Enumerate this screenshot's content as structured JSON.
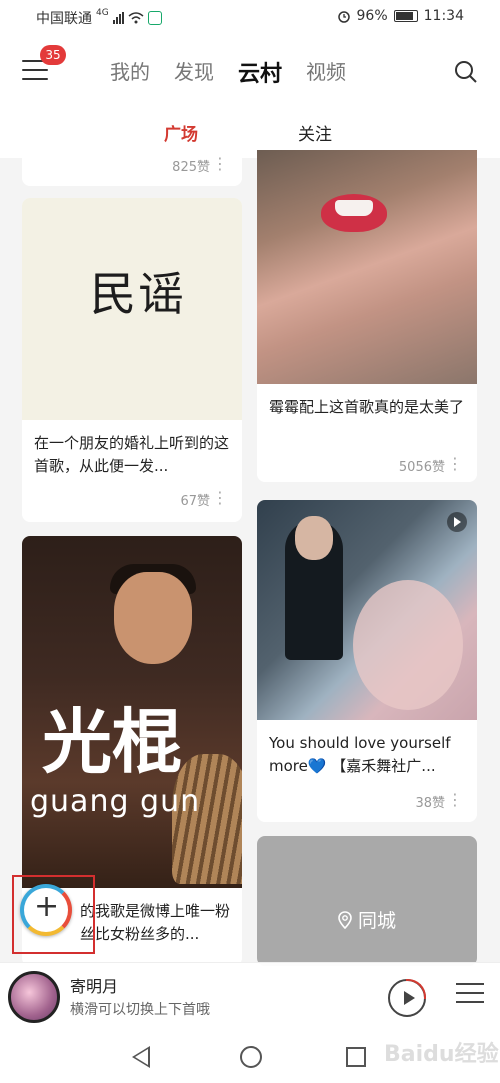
{
  "status_bar": {
    "carrier": "中国联通",
    "network": "4G",
    "battery": "96%",
    "time": "11:34"
  },
  "top_nav": {
    "badge_count": "35",
    "tabs": [
      {
        "label": "我的"
      },
      {
        "label": "发现"
      },
      {
        "label": "云村"
      },
      {
        "label": "视频"
      }
    ],
    "active_tab": "云村"
  },
  "sub_tabs": [
    {
      "label": "广场"
    },
    {
      "label": "关注"
    }
  ],
  "feed": {
    "left": [
      {
        "likes": "825赞"
      },
      {
        "image_text": "民谣",
        "caption": "在一个朋友的婚礼上听到的这首歌，从此便一发...",
        "likes": "67赞"
      },
      {
        "image_title": "光棍",
        "image_subtitle": "guang   gun",
        "caption": "的我歌是微博上唯一粉丝比女粉丝多的..."
      }
    ],
    "right": [
      {
        "caption": "霉霉配上这首歌真的是太美了",
        "likes": "5056赞"
      },
      {
        "caption": "You should love yourself more💙 【嘉禾舞社广...",
        "likes": "38赞"
      },
      {
        "label": "同城"
      }
    ]
  },
  "player": {
    "song": "寄明月",
    "hint": "横滑可以切换上下首哦"
  },
  "watermark": "Baidu经验"
}
